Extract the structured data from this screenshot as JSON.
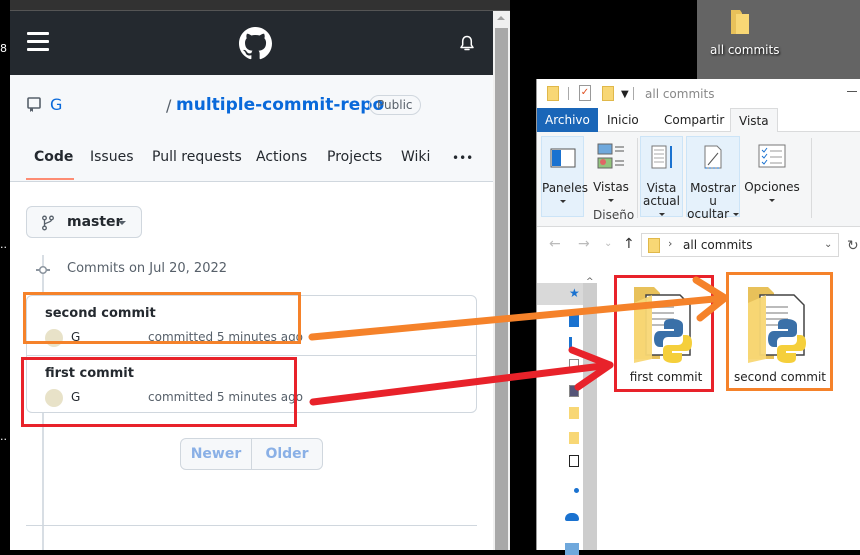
{
  "left_strip": {
    "marks": [
      "8",
      "..",
      ".."
    ]
  },
  "github": {
    "header": {
      "menu_icon": "hamburger-icon",
      "logo_icon": "github-octocat-icon",
      "notifications_icon": "bell-icon"
    },
    "repo": {
      "owner": "G",
      "separator": "/",
      "name": "multiple-commit-repo",
      "visibility_badge": "Public"
    },
    "tabs": [
      {
        "label": "Code",
        "active": true
      },
      {
        "label": "Issues"
      },
      {
        "label": "Pull requests"
      },
      {
        "label": "Actions"
      },
      {
        "label": "Projects"
      },
      {
        "label": "Wiki"
      },
      {
        "label": "•••"
      }
    ],
    "branch": {
      "label": "master"
    },
    "commits_heading": "Commits on Jul 20, 2022",
    "commits": [
      {
        "title": "second commit",
        "author": "G",
        "time": "committed 5 minutes ago",
        "highlight_color": "#f5822a"
      },
      {
        "title": "first commit",
        "author": "G",
        "time": "committed 5 minutes ago",
        "highlight_color": "#e8222a"
      }
    ],
    "pagination": {
      "newer": "Newer",
      "older": "Older"
    },
    "colors": {
      "link": "#0969da",
      "header_bg": "#24292f",
      "active_tab_underline": "#fd8c73"
    }
  },
  "desktop": {
    "folder_label": "all commits"
  },
  "explorer": {
    "title": "all commits",
    "ribbon_tabs": [
      "Archivo",
      "Inicio",
      "Compartir",
      "Vista"
    ],
    "active_ribbon_tab": "Vista",
    "ribbon_buttons": {
      "paneles": "Paneles",
      "vistas": "Vistas",
      "diseno_group": "Diseño",
      "vista_actual_1": "Vista",
      "vista_actual_2": "actual",
      "mostrar_1": "Mostrar u",
      "mostrar_2": "ocultar",
      "opciones": "Opciones"
    },
    "address": {
      "path": "all commits",
      "chevron": "›"
    },
    "nav": {
      "back": "←",
      "forward": "→",
      "recent": "⌄",
      "up": "↑",
      "refresh": "↻",
      "dropdown": "⌄"
    },
    "files": [
      {
        "name": "first commit",
        "highlight_color": "#e8222a"
      },
      {
        "name": "second commit",
        "highlight_color": "#f5822a"
      }
    ]
  },
  "annotations": {
    "arrow_colors": {
      "orange": "#f5822a",
      "red": "#e8222a"
    },
    "links": [
      {
        "from": "github commit: second commit",
        "to": "folder: second commit",
        "color": "orange"
      },
      {
        "from": "github commit: first commit",
        "to": "folder: first commit",
        "color": "red"
      }
    ]
  }
}
